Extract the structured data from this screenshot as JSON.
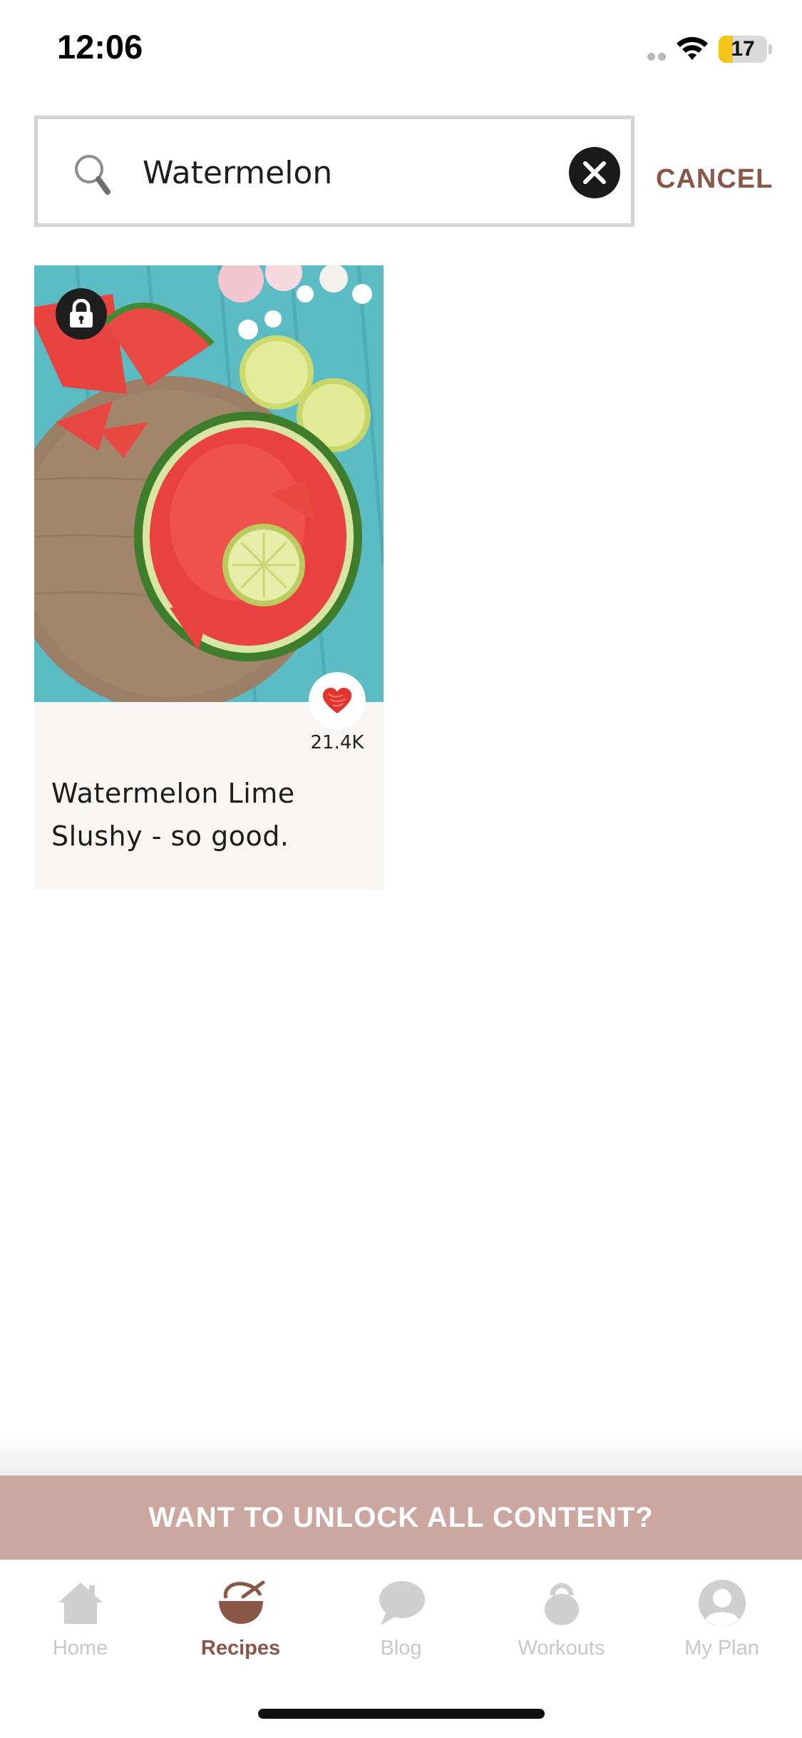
{
  "status_bar": {
    "time": "12:06",
    "battery_level": "17"
  },
  "search": {
    "query": "Watermelon",
    "cancel_label": "CANCEL"
  },
  "results": [
    {
      "title": "Watermelon Lime Slushy - so good.",
      "likes": "21.4K",
      "locked": true
    }
  ],
  "banner": {
    "text": "WANT TO UNLOCK ALL CONTENT?"
  },
  "tab_bar": {
    "tabs": [
      {
        "label": "Home",
        "icon": "home-icon",
        "active": false
      },
      {
        "label": "Recipes",
        "icon": "mixing-bowl-icon",
        "active": true
      },
      {
        "label": "Blog",
        "icon": "chat-bubble-icon",
        "active": false
      },
      {
        "label": "Workouts",
        "icon": "kettlebell-icon",
        "active": false
      },
      {
        "label": "My Plan",
        "icon": "profile-icon",
        "active": false
      }
    ]
  },
  "colors": {
    "accent": "#8a5647",
    "banner": "#cba79f",
    "inactive_tab": "#c8c8c8"
  }
}
